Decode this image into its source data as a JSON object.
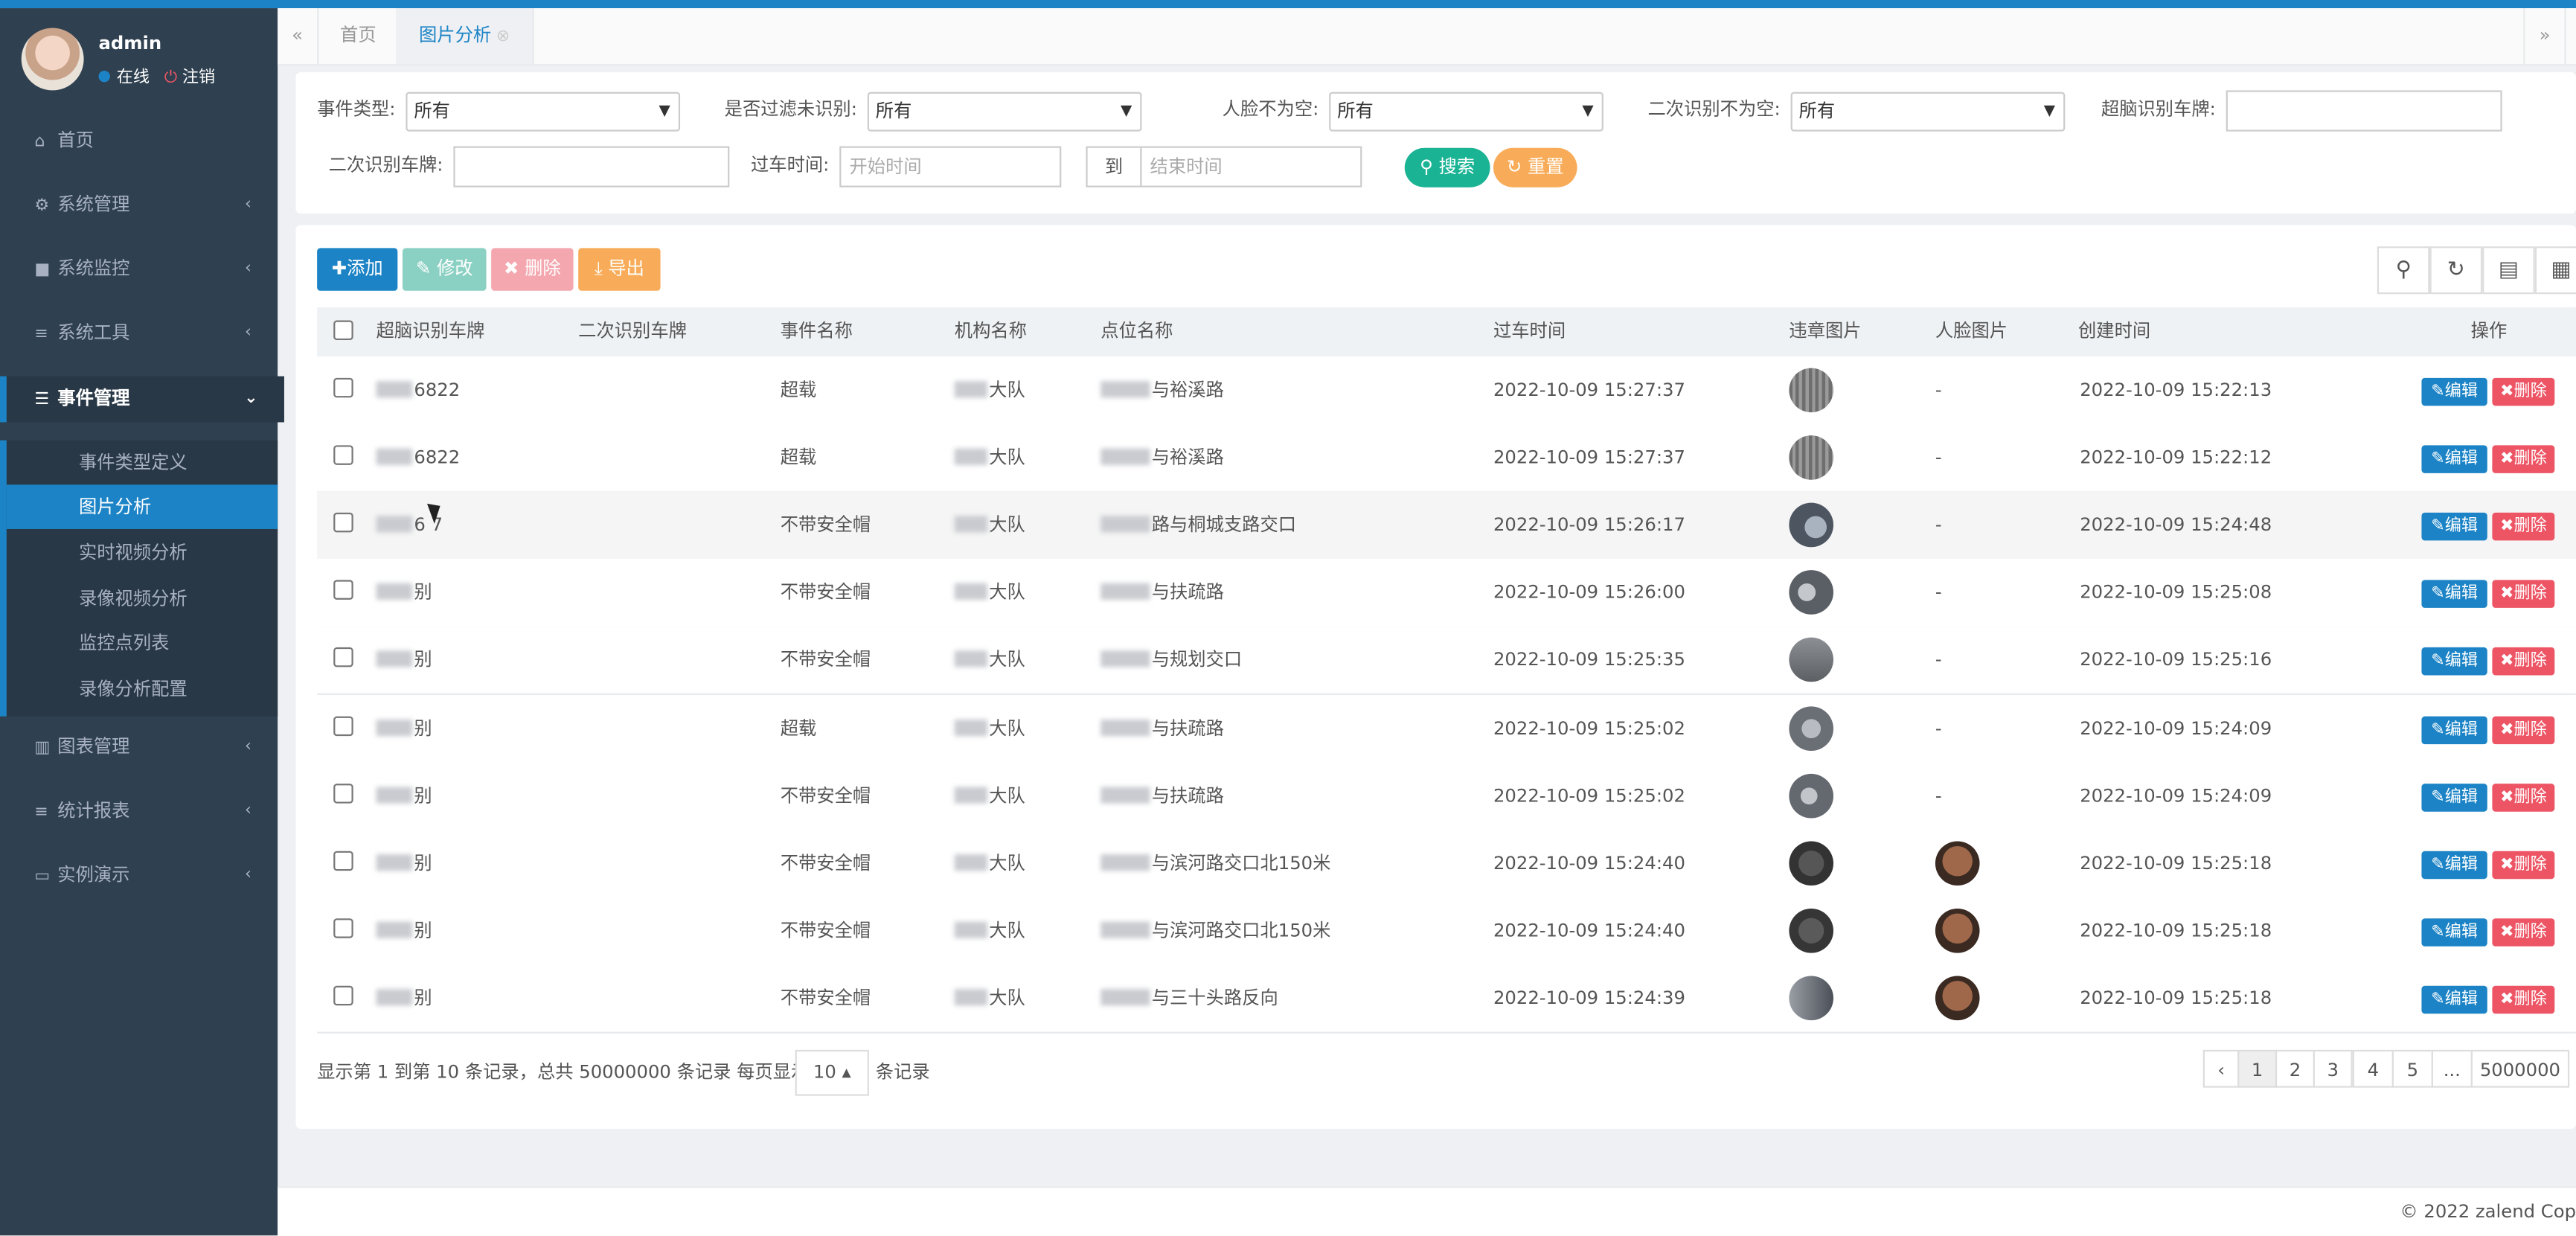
{
  "user": {
    "name": "admin",
    "status": "在线",
    "logout": "注销"
  },
  "nav": [
    {
      "label": "首页",
      "icon": "home-icon"
    },
    {
      "label": "系统管理",
      "icon": "gear-icon"
    },
    {
      "label": "系统监控",
      "icon": "video-icon"
    },
    {
      "label": "系统工具",
      "icon": "bars-icon"
    },
    {
      "label": "事件管理",
      "icon": "list-icon"
    },
    {
      "label": "图表管理",
      "icon": "bar-chart-icon"
    },
    {
      "label": "统计报表",
      "icon": "bars-icon"
    },
    {
      "label": "实例演示",
      "icon": "desktop-icon"
    }
  ],
  "submenu": [
    "事件类型定义",
    "图片分析",
    "实时视频分析",
    "录像视频分析",
    "监控点列表",
    "录像分析配置"
  ],
  "tabs": [
    "首页",
    "图片分析"
  ],
  "filters": {
    "event_type_label": "事件类型:",
    "event_type_value": "所有",
    "filter_unrecog_label": "是否过滤未识别:",
    "filter_unrecog_value": "所有",
    "face_not_empty_label": "人脸不为空:",
    "face_not_empty_value": "所有",
    "second_not_empty_label": "二次识别不为空:",
    "second_not_empty_value": "所有",
    "plate_label": "超脑识别车牌:",
    "second_plate_label": "二次识别车牌:",
    "time_label": "过车时间:",
    "start_placeholder": "开始时间",
    "to_label": "到",
    "end_placeholder": "结束时间",
    "search_btn": "搜索",
    "reset_btn": "重置"
  },
  "toolbar": {
    "add": "添加",
    "edit": "修改",
    "delete": "删除",
    "export": "导出"
  },
  "table": {
    "headers": [
      "超脑识别车牌",
      "二次识别车牌",
      "事件名称",
      "机构名称",
      "点位名称",
      "过车时间",
      "违章图片",
      "人脸图片",
      "创建时间",
      "操作"
    ],
    "edit_label": "编辑",
    "delete_label": "删除",
    "rows": [
      {
        "plate": "6822",
        "event": "超载",
        "org": "大队",
        "loc": "与裕溪路",
        "pass": "2022-10-09 15:27:37",
        "face": "-",
        "created": "2022-10-09 15:22:13"
      },
      {
        "plate": "6822",
        "event": "超载",
        "org": "大队",
        "loc": "与裕溪路",
        "pass": "2022-10-09 15:27:37",
        "face": "-",
        "created": "2022-10-09 15:22:12"
      },
      {
        "plate": "6 7",
        "event": "不带安全帽",
        "org": "大队",
        "loc": "路与桐城支路交口",
        "pass": "2022-10-09 15:26:17",
        "face": "-",
        "created": "2022-10-09 15:24:48"
      },
      {
        "plate": "别",
        "event": "不带安全帽",
        "org": "大队",
        "loc": "与扶疏路",
        "pass": "2022-10-09 15:26:00",
        "face": "-",
        "created": "2022-10-09 15:25:08"
      },
      {
        "plate": "别",
        "event": "不带安全帽",
        "org": "大队",
        "loc": "与规划交口",
        "pass": "2022-10-09 15:25:35",
        "face": "-",
        "created": "2022-10-09 15:25:16"
      },
      {
        "plate": "别",
        "event": "超载",
        "org": "大队",
        "loc": "与扶疏路",
        "pass": "2022-10-09 15:25:02",
        "face": "-",
        "created": "2022-10-09 15:24:09"
      },
      {
        "plate": "别",
        "event": "不带安全帽",
        "org": "大队",
        "loc": "与扶疏路",
        "pass": "2022-10-09 15:25:02",
        "face": "-",
        "created": "2022-10-09 15:24:09"
      },
      {
        "plate": "别",
        "event": "不带安全帽",
        "org": "大队",
        "loc": "与滨河路交口北150米",
        "pass": "2022-10-09 15:24:40",
        "face": "",
        "created": "2022-10-09 15:25:18"
      },
      {
        "plate": "别",
        "event": "不带安全帽",
        "org": "大队",
        "loc": "与滨河路交口北150米",
        "pass": "2022-10-09 15:24:40",
        "face": "",
        "created": "2022-10-09 15:25:18"
      },
      {
        "plate": "别",
        "event": "不带安全帽",
        "org": "大队",
        "loc": "与三十头路反向",
        "pass": "2022-10-09 15:24:39",
        "face": "",
        "created": "2022-10-09 15:25:18"
      }
    ]
  },
  "pagination": {
    "info": "显示第 1 到第 10 条记录，总共 50000000 条记录  每页显示",
    "page_size": "10",
    "suffix": "条记录",
    "prev": "‹",
    "pages": [
      "1",
      "2",
      "3",
      "4",
      "5",
      "...",
      "5000000"
    ]
  },
  "footer": {
    "copyright": "© 2022 zalend Cop"
  },
  "colors": {
    "primary": "#1c84c6",
    "edit": "#1ab394",
    "danger": "#ed5565",
    "warning": "#f8ac59",
    "sidebar": "#2f4050"
  }
}
